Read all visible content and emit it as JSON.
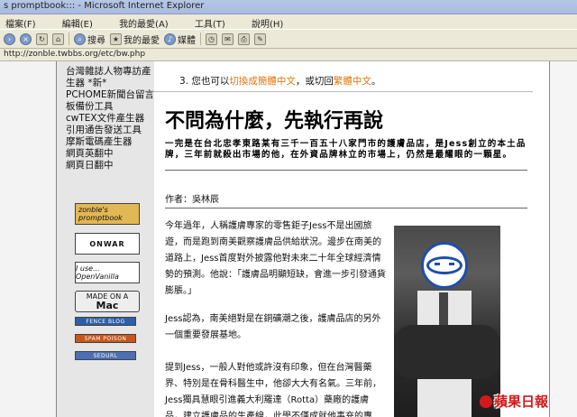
{
  "window": {
    "title": "s promptbook::: - Microsoft Internet Explorer"
  },
  "menu": [
    "檔案(F)",
    "編輯(E)",
    "我的最愛(A)",
    "工具(T)",
    "說明(H)"
  ],
  "toolbar": {
    "search": "搜尋",
    "favorites": "我的最愛",
    "media": "媒體"
  },
  "address": {
    "url": "http://zonble.twbbs.org/etc/bw.php"
  },
  "sidebar": {
    "links": [
      "台灣雜誌人物專訪產",
      "生器 *新*",
      "PCHOME新聞台留言",
      "板備份工具",
      "cwTEX文件產生器",
      "引用通告發送工具",
      "摩斯電碼產生器",
      "網頁英翻中",
      "網頁日翻中"
    ],
    "badges": {
      "zonble": "zonble's promptbook",
      "onwar": "ONWAR",
      "openvanilla": "I use... OpenVanilla",
      "mac_top": "MADE ON A",
      "mac_bottom": "Mac",
      "fence": "FENCE BLOG",
      "spam": "SPAM POISON",
      "sedurl": "SEDURL"
    }
  },
  "article": {
    "item3_prefix": "3.  您也可以",
    "item3_link1": "切換成簡體中文",
    "item3_mid": "，或切回",
    "item3_link2": "繁體中文",
    "item3_suffix": "。",
    "title": "不問為什麼，先執行再說",
    "lead": "一完是在台北忠孝東路某有三千一百五十八家門市的護膚品店，是Jess創立的本土品牌，三年前就殺出市場的他，在外資品牌林立的市場上，仍然是最耀眼的一顆星。",
    "author": "作者：吳林辰",
    "para1": "今年過年，人稱護膚專家的零售鉅子Jess不是出國旅遊，而是跑到南美觀察護膚品供給狀況。邊步在南美的道路上，Jess首度對外披露他對未來二十年全球經濟情勢的預測。他說：「護膚品明顯短缺，會進一步引發通貨膨脹。」",
    "para2": "Jess認為，南美絕對是在銅礦潮之後，護膚品店的另外一個重要發展基地。",
    "para3": "提到Jess，一般人對他或許沒有印象，但在台灣醫藥界、特別是在骨科醫生中，他卻大大有名氣。三年前，Jess獨具慧眼引進義大利羅達（Rotta）藥廠的護膚品，建立護膚品的生產線，此學不僅成就他事充的專"
  },
  "watermark": {
    "text": "蘋果日報"
  }
}
